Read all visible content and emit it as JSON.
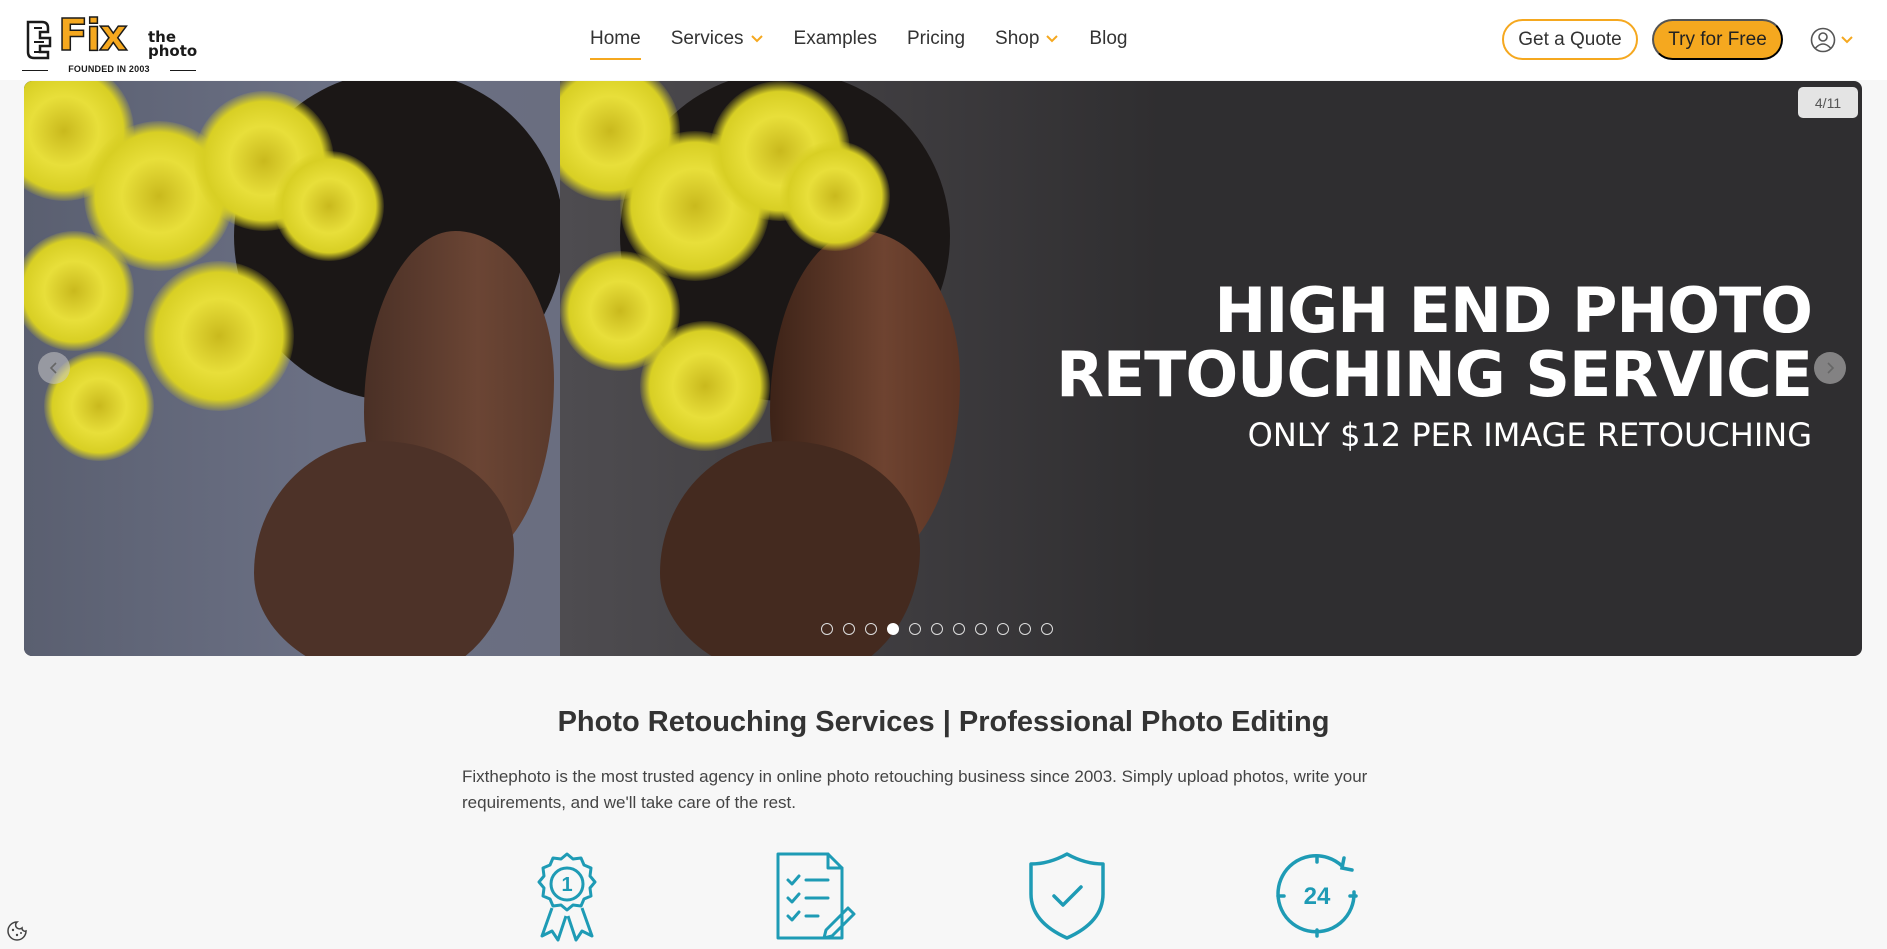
{
  "brand": {
    "logo_word": "Fix",
    "logo_the": "the",
    "logo_photo": "photo",
    "tagline": "FOUNDED IN 2003",
    "accent": "#f5a81f"
  },
  "nav": {
    "items": [
      {
        "label": "Home",
        "active": true,
        "dropdown": false
      },
      {
        "label": "Services",
        "active": false,
        "dropdown": true
      },
      {
        "label": "Examples",
        "active": false,
        "dropdown": false
      },
      {
        "label": "Pricing",
        "active": false,
        "dropdown": false
      },
      {
        "label": "Shop",
        "active": false,
        "dropdown": true
      },
      {
        "label": "Blog",
        "active": false,
        "dropdown": false
      }
    ]
  },
  "actions": {
    "quote_label": "Get a Quote",
    "try_label": "Try for Free",
    "user_icon": "user-circle-icon"
  },
  "hero": {
    "title_line1": "HIGH END PHOTO",
    "title_line2": "RETOUCHING SERVICE",
    "subtitle": "ONLY $12 PER IMAGE RETOUCHING",
    "counter": "4/11",
    "slide_count": 11,
    "active_slide": 4
  },
  "intro": {
    "title": "Photo Retouching Services | Professional Photo Editing",
    "description": "Fixthephoto is the most trusted agency in online photo retouching business since 2003. Simply upload photos, write your requirements, and we'll take care of the rest."
  },
  "features": {
    "icons": [
      "award-ribbon-icon",
      "checklist-document-icon",
      "shield-check-icon",
      "clock-24-icon"
    ],
    "icon_color": "#1e9bb5",
    "badge_number": "1",
    "clock_label": "24"
  }
}
